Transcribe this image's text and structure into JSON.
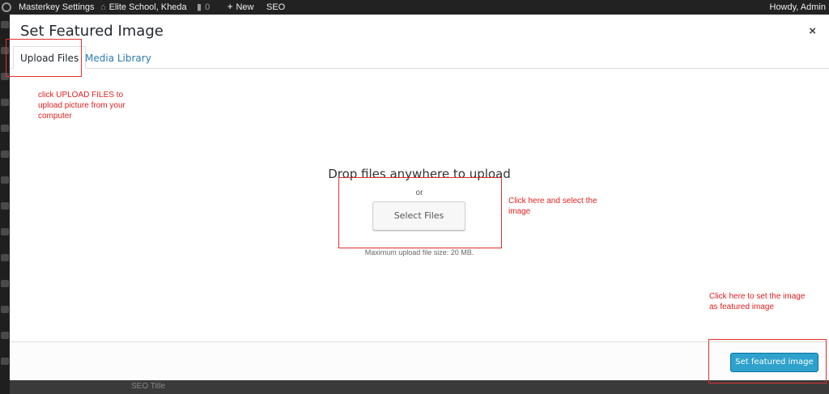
{
  "admin_bar": {
    "masterkey": "Masterkey Settings",
    "site_name": "Elite School, Kheda",
    "comments_count": "0",
    "new_label": "New",
    "seo_label": "SEO",
    "howdy": "Howdy, Admin"
  },
  "modal": {
    "title": "Set Featured Image",
    "close": "×",
    "tabs": [
      {
        "label": "Upload Files",
        "active": true
      },
      {
        "label": "Media Library",
        "active": false
      }
    ],
    "drop_title": "Drop files anywhere to upload",
    "or_text": "or",
    "select_files": "Select Files",
    "max_size": "Maximum upload file size: 20 MB.",
    "set_featured": "Set featured image"
  },
  "annotations": {
    "upload_note": "click UPLOAD FILES to upload picture from your computer",
    "select_note": "Click here and select the image",
    "featured_note": "Click here to set the image as featured image"
  },
  "background": {
    "label": "SEO Title"
  },
  "colors": {
    "accent": "#2ea2cc",
    "link": "#2a7ab0",
    "annotation": "#e02020"
  }
}
